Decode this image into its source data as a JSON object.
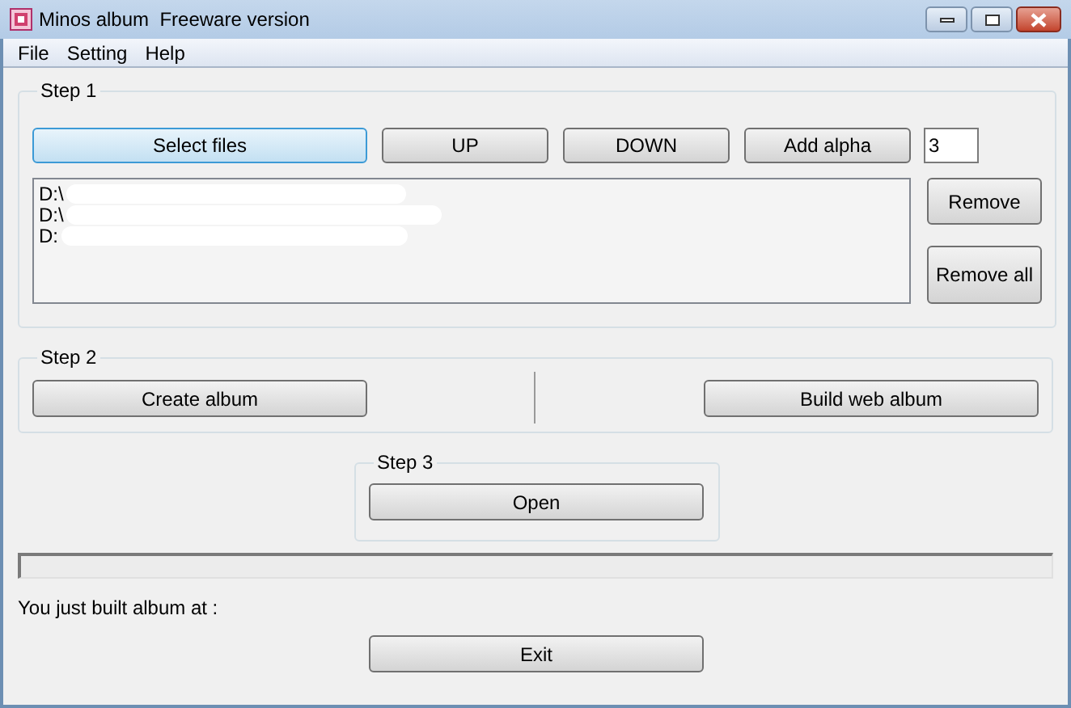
{
  "window": {
    "title": "Minos album  Freeware version"
  },
  "menu": [
    "File",
    "Setting",
    "Help"
  ],
  "step1": {
    "title": "Step 1",
    "buttons": [
      {
        "label": "Select files",
        "focused": true
      },
      {
        "label": "UP",
        "focused": false
      },
      {
        "label": "DOWN",
        "focused": false
      },
      {
        "label": "Add alpha",
        "focused": false
      }
    ],
    "alpha_value": "3",
    "files": [
      "D:\\",
      "D:\\",
      "D:"
    ],
    "remove_buttons": [
      "Remove",
      "Remove all"
    ]
  },
  "step2": {
    "title": "Step 2",
    "create_button": "Create album",
    "web_button": "Build web album"
  },
  "step3": {
    "title": "Step 3",
    "open_button": "Open"
  },
  "progress": {
    "level": 0
  },
  "status_text": "You just built album at :",
  "exit_button": "Exit"
}
